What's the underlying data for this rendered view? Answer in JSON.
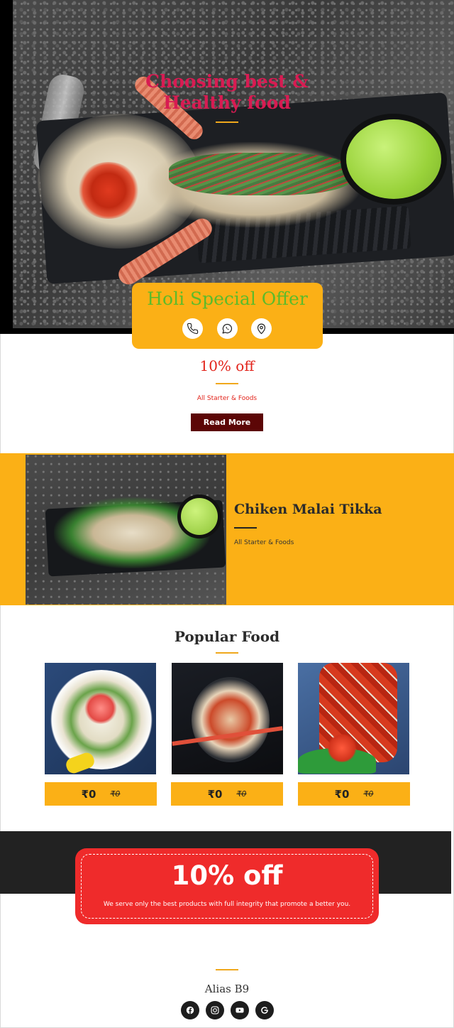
{
  "hero": {
    "title": "Choosing best & Healthy food"
  },
  "offer": {
    "title": "Holi Special Offer",
    "contacts": [
      {
        "icon": "phone-icon"
      },
      {
        "icon": "whatsapp-icon"
      },
      {
        "icon": "location-pin-icon"
      }
    ]
  },
  "discount": {
    "title": "10% off",
    "subtitle": "All Starter & Foods",
    "button": "Read More"
  },
  "feature": {
    "title": "Chiken Malai Tikka",
    "subtitle": "All Starter & Foods"
  },
  "popular": {
    "title": "Popular Food",
    "items": [
      {
        "price": "₹0",
        "old_price": "₹0"
      },
      {
        "price": "₹0",
        "old_price": "₹0"
      },
      {
        "price": "₹0",
        "old_price": "₹0"
      }
    ]
  },
  "promo": {
    "title": "10% off",
    "subtitle": "We serve only the best products with full integrity that promote a better you."
  },
  "footer": {
    "brand": "Alias B9",
    "social": [
      "facebook-icon",
      "instagram-icon",
      "youtube-icon",
      "google-icon"
    ]
  },
  "colors": {
    "accent": "#fbb016",
    "primary_red": "#e2231a",
    "title_pink": "#d81b52",
    "offer_green": "#5dbb2a",
    "button_dark": "#5c0606",
    "promo_red": "#ef2b2b",
    "dark_band": "#222222"
  }
}
